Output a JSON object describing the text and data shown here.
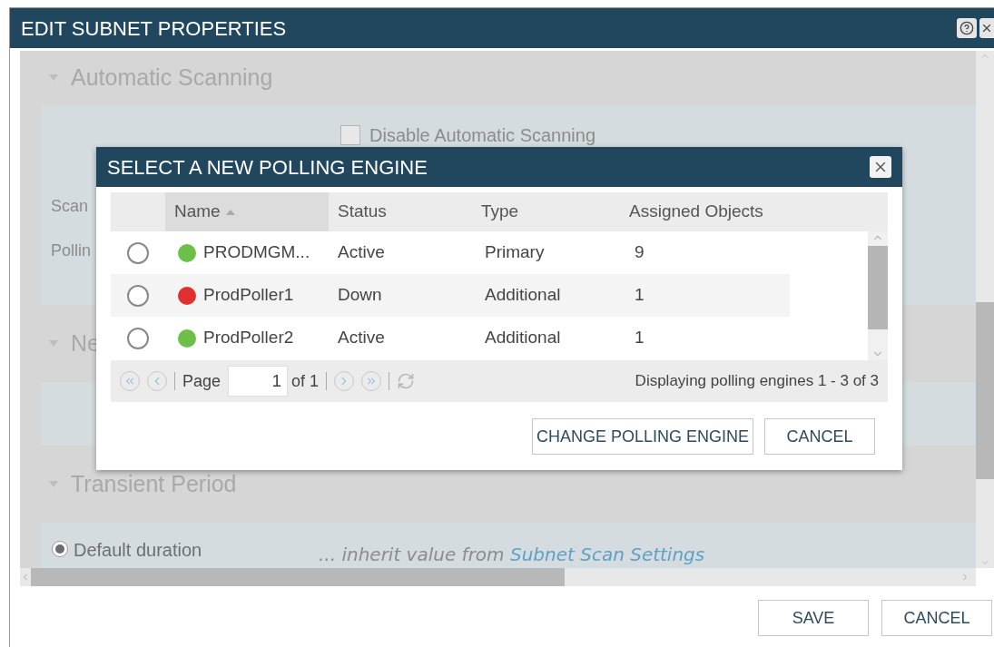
{
  "window": {
    "title": "EDIT SUBNET PROPERTIES"
  },
  "sections": [
    {
      "kind": "scanning",
      "title": "Automatic Scanning",
      "checkbox": {
        "label": "Disable Automatic Scanning",
        "checked": false
      },
      "labels": [
        "Scan",
        "Pollin"
      ]
    },
    {
      "kind": "plain",
      "title": "Ne"
    },
    {
      "kind": "transient",
      "title": "Transient Period",
      "radio": {
        "label": "Default duration",
        "selected": true
      },
      "note": "*... inherit value from*",
      "link": "Subnet Scan Settings"
    }
  ],
  "footer_buttons": [
    "SAVE",
    "CANCEL"
  ],
  "dialog": {
    "title": "SELECT A NEW POLLING ENGINE",
    "columns": [
      {
        "label": "Name",
        "sorted": true
      },
      {
        "label": "Status",
        "sorted": false
      },
      {
        "label": "Type",
        "sorted": false
      },
      {
        "label": "Assigned Objects",
        "sorted": false
      }
    ],
    "rows": [
      {
        "selected": false,
        "highlighted": false,
        "color": "#6cc04a",
        "name": "PRODMGM...",
        "status": "Active",
        "type": "Primary",
        "assigned": "9"
      },
      {
        "selected": false,
        "highlighted": true,
        "color": "#e0302f",
        "name": "ProdPoller1",
        "status": "Down",
        "type": "Additional",
        "assigned": "1"
      },
      {
        "selected": false,
        "highlighted": false,
        "color": "#6cc04a",
        "name": "ProdPoller2",
        "status": "Active",
        "type": "Additional",
        "assigned": "1"
      }
    ],
    "pager": {
      "page_label": "Page",
      "page": "1",
      "of": "of 1",
      "summary": "Displaying polling engines 1 - 3 of 3"
    },
    "buttons": [
      "CHANGE POLLING ENGINE",
      "CANCEL"
    ]
  }
}
